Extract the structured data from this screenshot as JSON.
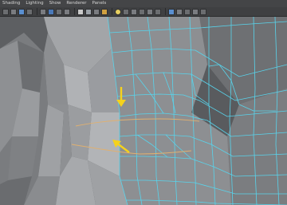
{
  "app": {
    "name": "Maya viewport"
  },
  "menu": {
    "items": [
      {
        "id": "shading",
        "label": "Shading"
      },
      {
        "id": "lighting",
        "label": "Lighting"
      },
      {
        "id": "show",
        "label": "Show"
      },
      {
        "id": "renderer",
        "label": "Renderer"
      },
      {
        "id": "panels",
        "label": "Panels"
      }
    ]
  },
  "toolbar": {
    "icons": [
      "select-camera-icon",
      "camera-attributes-icon",
      "bookmark-icon",
      "image-plane-icon",
      "grid-icon",
      "film-gate-icon",
      "resolution-gate-icon",
      "gate-mask-icon",
      "wireframe-icon",
      "smooth-shade-icon",
      "wireframe-on-shaded-icon",
      "textured-icon",
      "default-lighting-icon",
      "shadows-icon",
      "isolate-select-icon",
      "xray-icon",
      "xray-joints-icon",
      "backface-culling-icon",
      "high-quality-icon",
      "ambient-occlusion-icon",
      "motion-blur-icon",
      "anti-aliasing-icon",
      "depth-of-field-icon"
    ]
  },
  "viewport": {
    "model": "character-torso-mesh",
    "annotations": [
      {
        "name": "annotation-arrow-down",
        "color": "#f5d21c"
      },
      {
        "name": "annotation-arrow-up-left",
        "color": "#f5d21c"
      }
    ],
    "colors": {
      "background": "#5d5f62",
      "mesh_body": "#8a8c8f",
      "mesh_shadow": "#55575a",
      "wireframe_selected": "#58d4ec",
      "edge_loop_highlight": "#e0b070",
      "arrow": "#f5d21c"
    }
  }
}
